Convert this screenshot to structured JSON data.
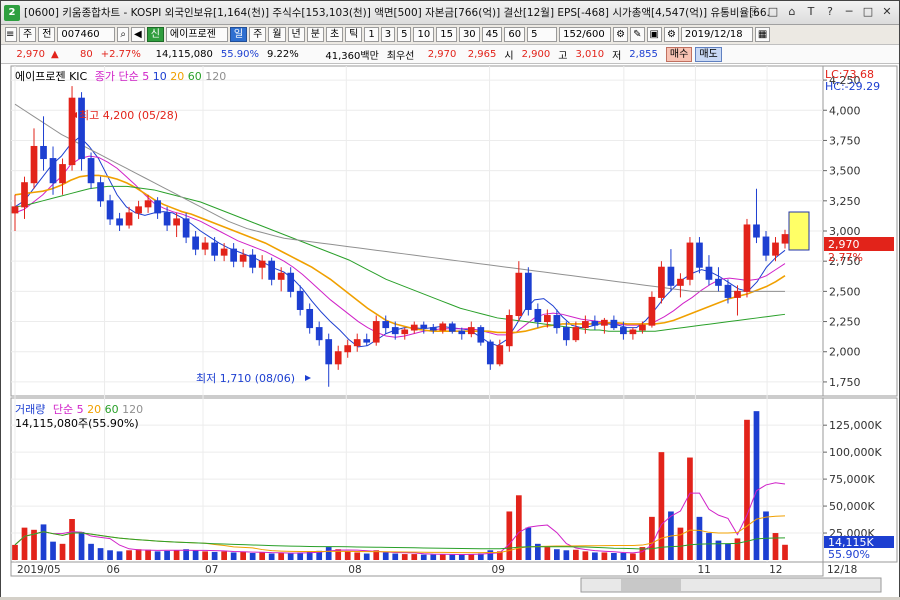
{
  "title_bar": {
    "app_number": "2",
    "text": "[0600] 키움종합차트 - KOSPI 외국인보유[1,164(천)] 주식수[153,103(천)] 액면[500] 자본금[766(억)] 결산[12월] EPS[-468] 시가총액[4,547(억)] 유통비율[66.",
    "buttons": [
      "⎘",
      "□",
      "⌂",
      "T",
      "?",
      "─",
      "□",
      "✕"
    ]
  },
  "toolbar": {
    "market_select": "주",
    "prev_label": "전",
    "stock_code": "007460",
    "credit_badge": "신",
    "stock_name": "에이프로젠",
    "period_buttons": [
      "일",
      "주",
      "월",
      "년",
      "분",
      "초",
      "틱"
    ],
    "active_period": "일",
    "interval_buttons": [
      "1",
      "3",
      "5",
      "10",
      "15",
      "30",
      "45",
      "60"
    ],
    "interval_value": "5",
    "bar_count": "152",
    "bar_total": "/600",
    "date": "2019/12/18"
  },
  "quote_bar": {
    "price": "2,970",
    "arrow": "▲",
    "change": "80",
    "change_pct": "+2.77%",
    "volume": "14,115,080",
    "volume_ratio": "55.90%",
    "turnover": "9.22%",
    "amount": "41,360백만",
    "quote_type": "최우선",
    "ask": "2,970",
    "bid": "2,965",
    "open_label": "시",
    "open": "2,900",
    "high_label": "고",
    "high": "3,010",
    "low_label": "저",
    "low": "2,855",
    "buy_label": "매수",
    "sell_label": "매도"
  },
  "price_panel": {
    "stock_label": "에이프로젠 KIC",
    "ma_label": "종가 단순",
    "ma_periods": [
      "5",
      "10",
      "20",
      "60",
      "120"
    ],
    "lc": "LC:73.68",
    "hc": "HC:-29.29",
    "high_annotation": "최고 4,200 (05/28)",
    "low_annotation": "최저 1,710 (08/06)",
    "current_price": "2,970",
    "current_pct": "2.77%",
    "y_ticks": [
      "4,250",
      "4,000",
      "3,750",
      "3,500",
      "3,250",
      "3,000",
      "2,750",
      "2,500",
      "2,250",
      "2,000",
      "1,750"
    ]
  },
  "volume_panel": {
    "label": "거래량",
    "ma_label": "단순",
    "ma_periods": [
      "5",
      "20",
      "60",
      "120"
    ],
    "value_text": "14,115,080주(55.90%)",
    "current_volume": "14,115K",
    "current_ratio": "55.90%",
    "y_ticks": [
      "125,000K",
      "100,000K",
      "75,000K",
      "50,000K",
      "25,000K"
    ]
  },
  "x_axis": {
    "labels": [
      "2019/05",
      "06",
      "07",
      "08",
      "09",
      "10",
      "11",
      "12"
    ],
    "end_date": "12/18"
  },
  "chart_data": {
    "type": "candlestick",
    "y_range": [
      1650,
      4350
    ],
    "volume_range_k": [
      0,
      140000
    ],
    "ma_colors": {
      "5": "#1d3fd1",
      "10": "#d022c8",
      "20": "#f0a000",
      "60": "#2aa02a",
      "120": "#909090"
    },
    "candles": [
      {
        "o": 3150,
        "h": 3300,
        "l": 3000,
        "c": 3200,
        "v": 14000
      },
      {
        "o": 3200,
        "h": 3450,
        "l": 3100,
        "c": 3400,
        "v": 30000
      },
      {
        "o": 3400,
        "h": 3850,
        "l": 3350,
        "c": 3700,
        "v": 28000
      },
      {
        "o": 3700,
        "h": 3950,
        "l": 3500,
        "c": 3600,
        "v": 33000
      },
      {
        "o": 3600,
        "h": 3700,
        "l": 3300,
        "c": 3400,
        "v": 17000
      },
      {
        "o": 3400,
        "h": 3600,
        "l": 3300,
        "c": 3550,
        "v": 15000
      },
      {
        "o": 3550,
        "h": 4200,
        "l": 3500,
        "c": 4100,
        "v": 38000
      },
      {
        "o": 4100,
        "h": 4150,
        "l": 3500,
        "c": 3600,
        "v": 26000
      },
      {
        "o": 3600,
        "h": 3650,
        "l": 3350,
        "c": 3400,
        "v": 15000
      },
      {
        "o": 3400,
        "h": 3450,
        "l": 3200,
        "c": 3250,
        "v": 11000
      },
      {
        "o": 3250,
        "h": 3300,
        "l": 3050,
        "c": 3100,
        "v": 9000
      },
      {
        "o": 3100,
        "h": 3150,
        "l": 3000,
        "c": 3050,
        "v": 8000
      },
      {
        "o": 3050,
        "h": 3200,
        "l": 3020,
        "c": 3150,
        "v": 9000
      },
      {
        "o": 3150,
        "h": 3250,
        "l": 3100,
        "c": 3200,
        "v": 10000
      },
      {
        "o": 3200,
        "h": 3300,
        "l": 3150,
        "c": 3250,
        "v": 9500
      },
      {
        "o": 3250,
        "h": 3280,
        "l": 3100,
        "c": 3150,
        "v": 8000
      },
      {
        "o": 3150,
        "h": 3200,
        "l": 3000,
        "c": 3050,
        "v": 8500
      },
      {
        "o": 3050,
        "h": 3150,
        "l": 2950,
        "c": 3100,
        "v": 9000
      },
      {
        "o": 3100,
        "h": 3150,
        "l": 2900,
        "c": 2950,
        "v": 10000
      },
      {
        "o": 2950,
        "h": 3000,
        "l": 2800,
        "c": 2850,
        "v": 9000
      },
      {
        "o": 2850,
        "h": 2950,
        "l": 2800,
        "c": 2900,
        "v": 8000
      },
      {
        "o": 2900,
        "h": 2950,
        "l": 2750,
        "c": 2800,
        "v": 7500
      },
      {
        "o": 2800,
        "h": 2900,
        "l": 2750,
        "c": 2850,
        "v": 8000
      },
      {
        "o": 2850,
        "h": 2900,
        "l": 2700,
        "c": 2750,
        "v": 7000
      },
      {
        "o": 2750,
        "h": 2850,
        "l": 2700,
        "c": 2800,
        "v": 7500
      },
      {
        "o": 2800,
        "h": 2850,
        "l": 2650,
        "c": 2700,
        "v": 6500
      },
      {
        "o": 2700,
        "h": 2800,
        "l": 2600,
        "c": 2750,
        "v": 7000
      },
      {
        "o": 2750,
        "h": 2780,
        "l": 2550,
        "c": 2600,
        "v": 6000
      },
      {
        "o": 2600,
        "h": 2700,
        "l": 2500,
        "c": 2650,
        "v": 6500
      },
      {
        "o": 2650,
        "h": 2700,
        "l": 2450,
        "c": 2500,
        "v": 6000
      },
      {
        "o": 2500,
        "h": 2550,
        "l": 2300,
        "c": 2350,
        "v": 7000
      },
      {
        "o": 2350,
        "h": 2400,
        "l": 2150,
        "c": 2200,
        "v": 8000
      },
      {
        "o": 2200,
        "h": 2250,
        "l": 2050,
        "c": 2100,
        "v": 8500
      },
      {
        "o": 2100,
        "h": 2150,
        "l": 1710,
        "c": 1900,
        "v": 12000
      },
      {
        "o": 1900,
        "h": 2050,
        "l": 1850,
        "c": 2000,
        "v": 10000
      },
      {
        "o": 2000,
        "h": 2100,
        "l": 1950,
        "c": 2050,
        "v": 8000
      },
      {
        "o": 2050,
        "h": 2150,
        "l": 2000,
        "c": 2100,
        "v": 7000
      },
      {
        "o": 2100,
        "h": 2150,
        "l": 2050,
        "c": 2080,
        "v": 6000
      },
      {
        "o": 2080,
        "h": 2300,
        "l": 2050,
        "c": 2250,
        "v": 9000
      },
      {
        "o": 2250,
        "h": 2300,
        "l": 2150,
        "c": 2200,
        "v": 7000
      },
      {
        "o": 2200,
        "h": 2250,
        "l": 2100,
        "c": 2150,
        "v": 6000
      },
      {
        "o": 2150,
        "h": 2200,
        "l": 2100,
        "c": 2180,
        "v": 5500
      },
      {
        "o": 2180,
        "h": 2250,
        "l": 2150,
        "c": 2220,
        "v": 5500
      },
      {
        "o": 2220,
        "h": 2250,
        "l": 2150,
        "c": 2200,
        "v": 5000
      },
      {
        "o": 2200,
        "h": 2230,
        "l": 2150,
        "c": 2180,
        "v": 5000
      },
      {
        "o": 2180,
        "h": 2250,
        "l": 2150,
        "c": 2230,
        "v": 5500
      },
      {
        "o": 2230,
        "h": 2250,
        "l": 2150,
        "c": 2170,
        "v": 5000
      },
      {
        "o": 2170,
        "h": 2200,
        "l": 2100,
        "c": 2150,
        "v": 5000
      },
      {
        "o": 2150,
        "h": 2250,
        "l": 2120,
        "c": 2200,
        "v": 5500
      },
      {
        "o": 2200,
        "h": 2220,
        "l": 2050,
        "c": 2080,
        "v": 6000
      },
      {
        "o": 2080,
        "h": 2100,
        "l": 1850,
        "c": 1900,
        "v": 9000
      },
      {
        "o": 1900,
        "h": 2100,
        "l": 1880,
        "c": 2050,
        "v": 8000
      },
      {
        "o": 2050,
        "h": 2350,
        "l": 2000,
        "c": 2300,
        "v": 45000
      },
      {
        "o": 2300,
        "h": 2750,
        "l": 2250,
        "c": 2650,
        "v": 60000
      },
      {
        "o": 2650,
        "h": 2700,
        "l": 2300,
        "c": 2350,
        "v": 30000
      },
      {
        "o": 2350,
        "h": 2400,
        "l": 2200,
        "c": 2250,
        "v": 15000
      },
      {
        "o": 2250,
        "h": 2350,
        "l": 2200,
        "c": 2300,
        "v": 12000
      },
      {
        "o": 2300,
        "h": 2350,
        "l": 2150,
        "c": 2200,
        "v": 10000
      },
      {
        "o": 2200,
        "h": 2250,
        "l": 2050,
        "c": 2100,
        "v": 9000
      },
      {
        "o": 2100,
        "h": 2250,
        "l": 2080,
        "c": 2200,
        "v": 9500
      },
      {
        "o": 2200,
        "h": 2300,
        "l": 2150,
        "c": 2250,
        "v": 8000
      },
      {
        "o": 2250,
        "h": 2300,
        "l": 2180,
        "c": 2220,
        "v": 7000
      },
      {
        "o": 2220,
        "h": 2280,
        "l": 2150,
        "c": 2260,
        "v": 7000
      },
      {
        "o": 2260,
        "h": 2300,
        "l": 2180,
        "c": 2200,
        "v": 6500
      },
      {
        "o": 2200,
        "h": 2250,
        "l": 2100,
        "c": 2150,
        "v": 6500
      },
      {
        "o": 2150,
        "h": 2200,
        "l": 2100,
        "c": 2180,
        "v": 6000
      },
      {
        "o": 2180,
        "h": 2250,
        "l": 2150,
        "c": 2220,
        "v": 12000
      },
      {
        "o": 2220,
        "h": 2500,
        "l": 2200,
        "c": 2450,
        "v": 40000
      },
      {
        "o": 2450,
        "h": 2750,
        "l": 2400,
        "c": 2700,
        "v": 100000
      },
      {
        "o": 2700,
        "h": 2850,
        "l": 2500,
        "c": 2550,
        "v": 45000
      },
      {
        "o": 2550,
        "h": 2650,
        "l": 2450,
        "c": 2600,
        "v": 30000
      },
      {
        "o": 2600,
        "h": 2950,
        "l": 2550,
        "c": 2900,
        "v": 95000
      },
      {
        "o": 2900,
        "h": 2950,
        "l": 2650,
        "c": 2700,
        "v": 40000
      },
      {
        "o": 2700,
        "h": 2800,
        "l": 2550,
        "c": 2600,
        "v": 25000
      },
      {
        "o": 2600,
        "h": 2700,
        "l": 2500,
        "c": 2550,
        "v": 18000
      },
      {
        "o": 2550,
        "h": 2600,
        "l": 2400,
        "c": 2450,
        "v": 15000
      },
      {
        "o": 2450,
        "h": 2550,
        "l": 2300,
        "c": 2500,
        "v": 20000
      },
      {
        "o": 2500,
        "h": 3100,
        "l": 2450,
        "c": 3050,
        "v": 130000
      },
      {
        "o": 3050,
        "h": 3350,
        "l": 2900,
        "c": 2950,
        "v": 138000
      },
      {
        "o": 2950,
        "h": 3000,
        "l": 2750,
        "c": 2800,
        "v": 45000
      },
      {
        "o": 2800,
        "h": 2950,
        "l": 2750,
        "c": 2900,
        "v": 25000
      },
      {
        "o": 2900,
        "h": 3010,
        "l": 2855,
        "c": 2970,
        "v": 14115
      }
    ],
    "ma_lines": {
      "5": [
        3200,
        3250,
        3350,
        3450,
        3550,
        3620,
        3720,
        3780,
        3700,
        3600,
        3450,
        3300,
        3200,
        3150,
        3130,
        3150,
        3160,
        3150,
        3110,
        3060,
        3000,
        2950,
        2900,
        2860,
        2830,
        2800,
        2770,
        2730,
        2690,
        2660,
        2600,
        2520,
        2420,
        2330,
        2250,
        2180,
        2100,
        2040,
        2050,
        2100,
        2150,
        2180,
        2200,
        2200,
        2190,
        2200,
        2210,
        2200,
        2190,
        2180,
        2130,
        2080,
        2050,
        2100,
        2220,
        2350,
        2430,
        2440,
        2380,
        2290,
        2220,
        2200,
        2210,
        2230,
        2230,
        2220,
        2200,
        2200,
        2260,
        2350,
        2450,
        2530,
        2600,
        2650,
        2680,
        2660,
        2620,
        2570,
        2520,
        2500,
        2580,
        2700,
        2780,
        2840
      ],
      "10": [
        3150,
        3180,
        3240,
        3300,
        3380,
        3450,
        3550,
        3600,
        3620,
        3610,
        3570,
        3520,
        3450,
        3380,
        3300,
        3230,
        3190,
        3160,
        3140,
        3110,
        3080,
        3040,
        3000,
        2960,
        2920,
        2890,
        2860,
        2830,
        2790,
        2750,
        2700,
        2640,
        2570,
        2500,
        2430,
        2370,
        2310,
        2250,
        2200,
        2160,
        2130,
        2120,
        2130,
        2150,
        2170,
        2180,
        2190,
        2190,
        2190,
        2190,
        2180,
        2160,
        2140,
        2140,
        2160,
        2220,
        2280,
        2310,
        2320,
        2310,
        2290,
        2270,
        2260,
        2250,
        2240,
        2230,
        2220,
        2220,
        2230,
        2250,
        2290,
        2340,
        2400,
        2450,
        2510,
        2560,
        2600,
        2610,
        2600,
        2590,
        2600,
        2630,
        2680,
        2730
      ],
      "20": [
        3300,
        3310,
        3320,
        3330,
        3350,
        3380,
        3420,
        3450,
        3460,
        3460,
        3450,
        3430,
        3400,
        3360,
        3310,
        3260,
        3220,
        3190,
        3160,
        3140,
        3110,
        3080,
        3050,
        3020,
        2990,
        2960,
        2930,
        2900,
        2860,
        2820,
        2780,
        2740,
        2700,
        2650,
        2600,
        2540,
        2480,
        2420,
        2360,
        2310,
        2260,
        2230,
        2210,
        2190,
        2180,
        2170,
        2170,
        2170,
        2170,
        2170,
        2170,
        2170,
        2160,
        2160,
        2160,
        2170,
        2190,
        2210,
        2220,
        2230,
        2230,
        2230,
        2230,
        2240,
        2240,
        2240,
        2230,
        2230,
        2230,
        2230,
        2240,
        2260,
        2290,
        2320,
        2350,
        2380,
        2410,
        2440,
        2460,
        2480,
        2510,
        2540,
        2580,
        2630
      ],
      "60": [
        3200,
        3210,
        3230,
        3250,
        3270,
        3290,
        3310,
        3330,
        3350,
        3360,
        3370,
        3370,
        3370,
        3360,
        3350,
        3340,
        3320,
        3300,
        3280,
        3260,
        3240,
        3210,
        3180,
        3150,
        3120,
        3090,
        3060,
        3030,
        3000,
        2970,
        2940,
        2910,
        2880,
        2850,
        2820,
        2790,
        2760,
        2720,
        2680,
        2640,
        2600,
        2570,
        2540,
        2510,
        2480,
        2450,
        2420,
        2390,
        2360,
        2340,
        2320,
        2300,
        2280,
        2270,
        2260,
        2250,
        2240,
        2230,
        2220,
        2210,
        2200,
        2190,
        2180,
        2180,
        2170,
        2170,
        2170,
        2170,
        2170,
        2170,
        2180,
        2190,
        2200,
        2210,
        2220,
        2230,
        2240,
        2250,
        2260,
        2270,
        2280,
        2290,
        2300,
        2310
      ],
      "120": [
        4050,
        4000,
        3950,
        3900,
        3850,
        3800,
        3760,
        3720,
        3680,
        3640,
        3600,
        3560,
        3520,
        3480,
        3440,
        3400,
        3360,
        3320,
        3280,
        3240,
        3200,
        3160,
        3120,
        3080,
        3050,
        3020,
        3000,
        2980,
        2960,
        2940,
        2930,
        2920,
        2910,
        2900,
        2890,
        2880,
        2870,
        2860,
        2850,
        2840,
        2830,
        2820,
        2810,
        2800,
        2790,
        2780,
        2770,
        2760,
        2750,
        2740,
        2730,
        2720,
        2710,
        2700,
        2690,
        2680,
        2670,
        2660,
        2650,
        2640,
        2630,
        2620,
        2610,
        2600,
        2590,
        2580,
        2570,
        2560,
        2550,
        2540,
        2530,
        2520,
        2510,
        2500,
        2500,
        2500,
        2500,
        2500,
        2500,
        2500,
        2500,
        2500,
        2500,
        2500
      ]
    }
  }
}
